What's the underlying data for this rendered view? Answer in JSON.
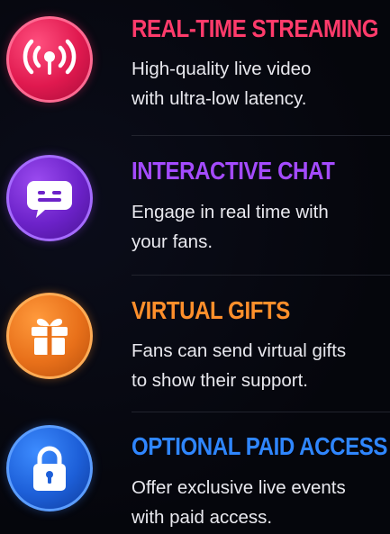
{
  "colors": {
    "background": "#05060c",
    "streaming": "#ff3b6b",
    "chat": "#a44bff",
    "gifts": "#ff8f2b",
    "paid_access": "#2f86ff",
    "text": "#e9e9ef"
  },
  "features": [
    {
      "icon": "live-broadcast-icon",
      "title": "REAL-TIME STREAMING",
      "lines": [
        "High-quality live video",
        "with ultra-low latency."
      ]
    },
    {
      "icon": "chat-bubble-icon",
      "title": "INTERACTIVE CHAT",
      "lines": [
        "Engage in real time with",
        "your fans."
      ]
    },
    {
      "icon": "gift-icon",
      "title": "VIRTUAL GIFTS",
      "lines": [
        "Fans can send virtual gifts",
        "to show their support."
      ]
    },
    {
      "icon": "padlock-icon",
      "title": "OPTIONAL PAID ACCESS",
      "lines": [
        "Offer exclusive live events",
        "with paid access."
      ]
    }
  ]
}
